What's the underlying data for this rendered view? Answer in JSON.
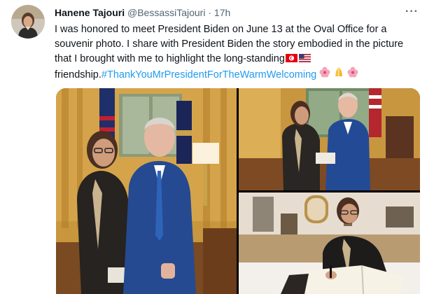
{
  "author": {
    "name": "Hanene Tajouri",
    "handle": "@BessassiTajouri",
    "separator": "·",
    "time": "17h"
  },
  "more_label": "···",
  "tweet": {
    "text": "I was honored to meet President Biden on June 13 at the Oval Office for a souvenir photo. I share with President Biden the story embodied in the picture that I brought with me to highlight the long-standing",
    "after_flags": "friendship.",
    "hashtag": "#ThankYouMrPresidentForTheWarmWelcoming"
  },
  "icons": {
    "avatar": "profile-photo",
    "more": "more-dots-icon",
    "flags": [
      "tunisia-flag-icon",
      "usa-flag-icon"
    ],
    "emoji": [
      "hibiscus-icon",
      "folded-hands-icon",
      "hibiscus-icon"
    ]
  },
  "colors": {
    "link": "#1d9bf0",
    "muted": "#536471",
    "text": "#0f1419"
  }
}
